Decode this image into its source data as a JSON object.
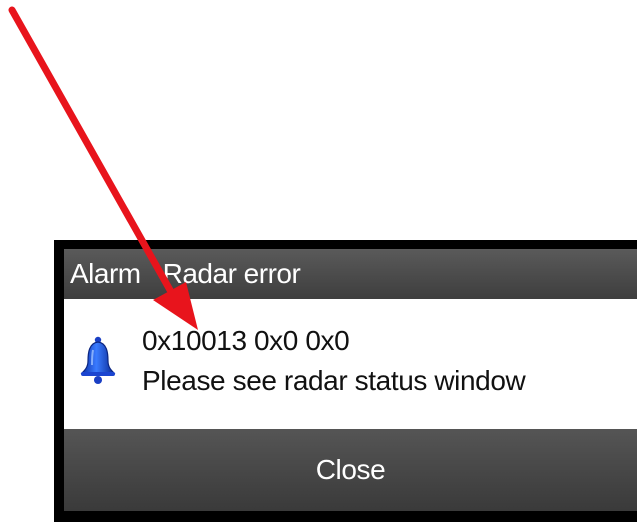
{
  "dialog": {
    "title_label": "Alarm",
    "title_text": "Radar error",
    "message": {
      "line1": "0x10013 0x0 0x0",
      "line2": "Please see radar status window"
    },
    "close_label": "Close"
  },
  "icons": {
    "alarm": "bell-icon",
    "annotation": "red-arrow-annotation"
  },
  "colors": {
    "bell_blue": "#1e4fd6",
    "arrow_red": "#e8141c",
    "dialog_border": "#000000",
    "bar_gray": "#4a4a4a"
  }
}
